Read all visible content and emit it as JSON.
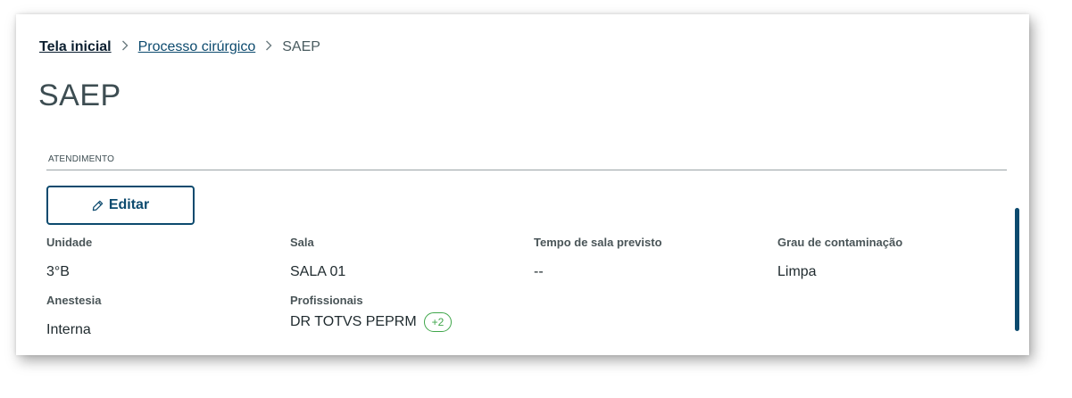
{
  "breadcrumb": {
    "home": "Tela inicial",
    "parent": "Processo cirúrgico",
    "current": "SAEP"
  },
  "page": {
    "title": "SAEP"
  },
  "section": {
    "label": "ATENDIMENTO"
  },
  "actions": {
    "edit_label": "Editar",
    "edit_icon": "pencil-icon"
  },
  "fields": {
    "unidade": {
      "label": "Unidade",
      "value": "3°B"
    },
    "sala": {
      "label": "Sala",
      "value": "SALA 01"
    },
    "tempo": {
      "label": "Tempo de sala previsto",
      "value": "--"
    },
    "grau": {
      "label": "Grau de contaminação",
      "value": "Limpa"
    },
    "anestesia": {
      "label": "Anestesia",
      "value": "Interna"
    },
    "profissionais": {
      "label": "Profissionais",
      "value": "DR TOTVS PEPRM",
      "more": "+2"
    }
  },
  "colors": {
    "primary": "#0c4a6e",
    "badge": "#3fa64a",
    "text": "#1f2a2e"
  }
}
